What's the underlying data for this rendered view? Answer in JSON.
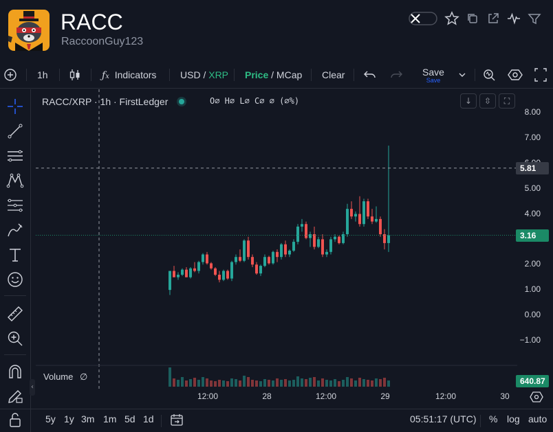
{
  "header": {
    "title": "RACC",
    "owner": "RaccoonGuy123",
    "icons": [
      "x-toggle-icon",
      "star-icon",
      "copy-icon",
      "external-link-icon",
      "activity-icon",
      "filter-icon"
    ]
  },
  "toolbar": {
    "interval": "1h",
    "indicators_label": "Indicators",
    "quote_usd": "USD",
    "quote_sep": "/",
    "quote_xrp": "XRP",
    "price_label": "Price",
    "mcap_sep": "/",
    "mcap_label": "MCap",
    "clear_label": "Clear",
    "save_label": "Save",
    "save_sub": "Save"
  },
  "chart": {
    "symbol_line": "RACC/XRP · 1h · FirstLedger",
    "ohlc": "O∅ H∅ L∅ C∅ ∅ (∅%)",
    "volume_label": "Volume",
    "volume_value": "∅",
    "crosshair_price": "5.81",
    "last_price": "3.16",
    "volume_tag": "640.87",
    "y_ticks": [
      "8.00",
      "7.00",
      "6.00",
      "5.00",
      "4.00",
      "3.00",
      "2.00",
      "1.00",
      "0.00",
      "−1.00"
    ],
    "x_ticks": [
      "12:00",
      "28",
      "12:00",
      "29",
      "12:00",
      "30"
    ],
    "colors": {
      "up": "#26a69a",
      "down": "#ef5350",
      "last": "#1b8a66",
      "bg": "#131722"
    }
  },
  "chart_data": {
    "type": "candlestick",
    "ylim": [
      -1.5,
      8.3
    ],
    "candles": [
      [
        1.0,
        1.75,
        0.8,
        1.75
      ],
      [
        1.75,
        1.95,
        1.5,
        1.5
      ],
      [
        1.5,
        1.7,
        1.4,
        1.6
      ],
      [
        1.6,
        1.85,
        1.55,
        1.8
      ],
      [
        1.8,
        1.9,
        1.5,
        1.5
      ],
      [
        1.5,
        1.9,
        1.45,
        1.85
      ],
      [
        1.85,
        2.1,
        1.7,
        1.75
      ],
      [
        1.75,
        2.15,
        1.65,
        2.1
      ],
      [
        2.1,
        2.45,
        2.0,
        2.4
      ],
      [
        2.4,
        2.5,
        2.0,
        2.05
      ],
      [
        2.05,
        2.1,
        1.8,
        1.85
      ],
      [
        1.85,
        1.9,
        1.55,
        1.6
      ],
      [
        1.6,
        1.75,
        1.3,
        1.4
      ],
      [
        1.4,
        1.8,
        1.35,
        1.75
      ],
      [
        1.75,
        1.8,
        1.4,
        1.45
      ],
      [
        1.45,
        2.15,
        1.35,
        2.1
      ],
      [
        2.1,
        2.4,
        2.0,
        2.3
      ],
      [
        2.3,
        2.6,
        2.1,
        2.15
      ],
      [
        2.15,
        3.0,
        2.1,
        2.95
      ],
      [
        2.95,
        3.1,
        2.2,
        2.3
      ],
      [
        2.3,
        2.4,
        1.9,
        2.0
      ],
      [
        2.0,
        2.1,
        1.6,
        1.65
      ],
      [
        1.65,
        2.0,
        1.55,
        1.95
      ],
      [
        1.95,
        2.4,
        1.9,
        2.3
      ],
      [
        2.3,
        2.35,
        2.0,
        2.05
      ],
      [
        2.05,
        2.55,
        2.0,
        2.5
      ],
      [
        2.5,
        2.6,
        2.1,
        2.3
      ],
      [
        2.3,
        2.85,
        2.2,
        2.8
      ],
      [
        2.8,
        2.95,
        2.3,
        2.4
      ],
      [
        2.4,
        2.6,
        2.3,
        2.55
      ],
      [
        2.55,
        3.0,
        2.5,
        2.9
      ],
      [
        2.9,
        3.6,
        2.8,
        3.5
      ],
      [
        3.5,
        3.8,
        3.3,
        3.6
      ],
      [
        3.6,
        3.7,
        3.0,
        3.05
      ],
      [
        3.05,
        3.3,
        2.7,
        3.2
      ],
      [
        3.2,
        3.5,
        2.6,
        2.7
      ],
      [
        2.7,
        3.1,
        2.65,
        3.0
      ],
      [
        3.0,
        3.2,
        2.3,
        2.4
      ],
      [
        2.4,
        2.6,
        2.3,
        2.5
      ],
      [
        2.5,
        3.1,
        2.4,
        3.0
      ],
      [
        3.0,
        3.2,
        2.9,
        3.1
      ],
      [
        3.1,
        3.15,
        2.8,
        2.85
      ],
      [
        2.85,
        3.3,
        2.8,
        3.2
      ],
      [
        3.2,
        4.4,
        3.1,
        4.2
      ],
      [
        4.2,
        4.5,
        3.8,
        3.9
      ],
      [
        3.9,
        4.1,
        3.7,
        4.0
      ],
      [
        4.0,
        4.7,
        3.5,
        3.6
      ],
      [
        3.6,
        4.6,
        3.5,
        4.5
      ],
      [
        4.5,
        4.6,
        3.8,
        3.9
      ],
      [
        3.9,
        4.2,
        3.6,
        3.7
      ],
      [
        3.7,
        4.3,
        3.65,
        3.8
      ],
      [
        3.8,
        3.9,
        3.1,
        3.2
      ],
      [
        3.2,
        3.4,
        2.6,
        2.85
      ],
      [
        2.85,
        6.7,
        2.5,
        3.16
      ]
    ],
    "volumes": [
      28,
      12,
      10,
      14,
      9,
      11,
      13,
      10,
      14,
      12,
      9,
      8,
      10,
      9,
      8,
      12,
      11,
      9,
      16,
      14,
      10,
      9,
      8,
      11,
      10,
      9,
      12,
      10,
      11,
      9,
      10,
      15,
      12,
      11,
      13,
      14,
      9,
      12,
      10,
      9,
      11,
      8,
      10,
      14,
      12,
      9,
      13,
      11,
      10,
      9,
      12,
      11,
      13,
      9
    ]
  }
}
